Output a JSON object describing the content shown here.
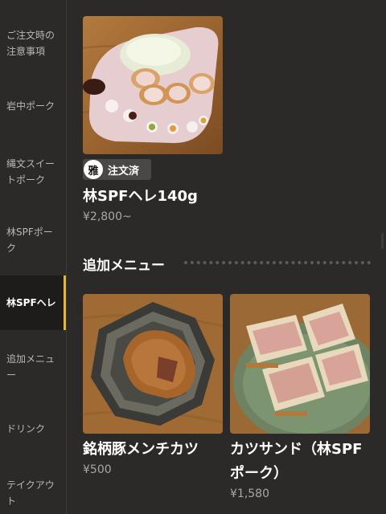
{
  "sidebar": {
    "items": [
      {
        "label": "ご注文時の注意事項"
      },
      {
        "label": "岩中ポーク"
      },
      {
        "label": "縄文スイートポーク"
      },
      {
        "label": "林SPFポーク"
      },
      {
        "label": "林SPFヘレ"
      },
      {
        "label": "追加メニュー"
      },
      {
        "label": "ドリンク"
      },
      {
        "label": "テイクアウト"
      }
    ],
    "active_index": 4,
    "accent_color": "#e5b730"
  },
  "featured_item": {
    "badge_icon": "雅",
    "badge_label": "注文済",
    "name": "林SPFヘレ140g",
    "price": "¥2,800~"
  },
  "section": {
    "title": "追加メニュー"
  },
  "menu_items": [
    {
      "name": "銘柄豚メンチカツ",
      "price": "¥500"
    },
    {
      "name": "カツサンド（林SPFポーク）",
      "price": "¥1,580"
    }
  ]
}
